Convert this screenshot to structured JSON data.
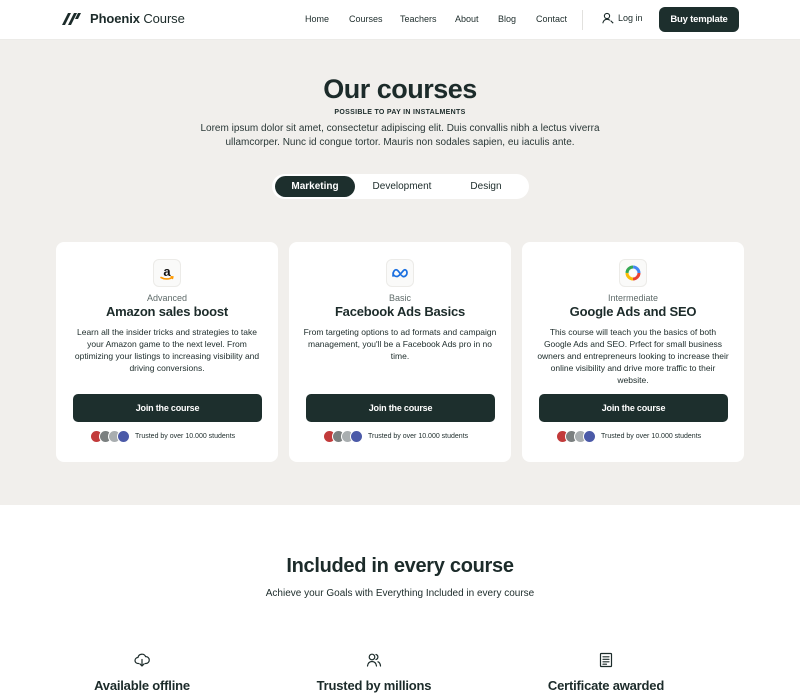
{
  "header": {
    "brand_bold": "Phoenix",
    "brand_regular": "Course",
    "nav": [
      "Home",
      "Courses",
      "Teachers",
      "About",
      "Blog",
      "Contact"
    ],
    "login_label": "Log in",
    "buy_label": "Buy template"
  },
  "hero": {
    "title": "Our courses",
    "subtitle": "POSSIBLE TO PAY IN INSTALMENTS",
    "description": "Lorem ipsum dolor sit amet, consectetur adipiscing elit. Duis convallis nibh a lectus viverra ullamcorper. Nunc id congue tortor. Mauris non sodales sapien, eu iaculis ante."
  },
  "tabs": [
    {
      "label": "Marketing",
      "active": true
    },
    {
      "label": "Development",
      "active": false
    },
    {
      "label": "Design",
      "active": false
    }
  ],
  "cards": [
    {
      "icon": "amazon-icon",
      "level": "Advanced",
      "title": "Amazon sales boost",
      "description": "Learn all the insider tricks and strategies to take your Amazon game to the next level. From optimizing your listings to increasing visibility and driving conversions.",
      "button": "Join the course",
      "trusted": "Trusted by over 10.000 students"
    },
    {
      "icon": "meta-icon",
      "level": "Basic",
      "title": "Facebook Ads Basics",
      "description": "From targeting options to ad formats and campaign management, you'll be a Facebook Ads pro in no time.",
      "button": "Join the course",
      "trusted": "Trusted by over 10.000 students"
    },
    {
      "icon": "google-ads-icon",
      "level": "Intermediate",
      "title": "Google Ads and SEO",
      "description": "This course will teach you the basics of both Google Ads and SEO. Prfect for small business owners and entrepreneurs looking to increase their online visibility and drive more traffic to their website.",
      "button": "Join the course",
      "trusted": "Trusted by over 10.000 students"
    }
  ],
  "included": {
    "title": "Included in every course",
    "subtitle": "Achieve your Goals with Everything Included in every course",
    "features": [
      {
        "icon": "cloud-download-icon",
        "label": "Available offline"
      },
      {
        "icon": "users-icon",
        "label": "Trusted by millions"
      },
      {
        "icon": "certificate-icon",
        "label": "Certificate awarded"
      }
    ]
  },
  "colors": {
    "primary": "#1d2f2d",
    "background": "#f1efec",
    "surface": "#ffffff"
  }
}
